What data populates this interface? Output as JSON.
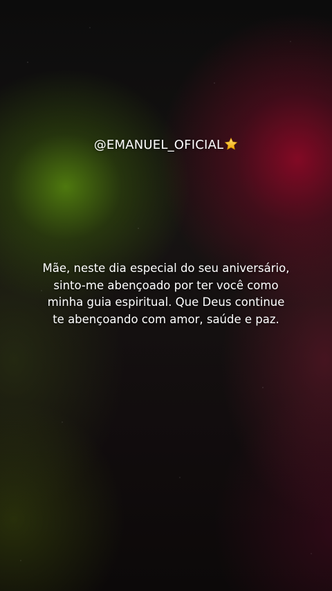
{
  "post": {
    "handle": "@EMANUEL_OFICIAL",
    "handle_icon": "star-icon",
    "message": "Mãe, neste dia especial do seu aniversário, sinto-me abençoado por ter você como minha guia espiritual. Que Deus continue te abençoando com amor, saúde e paz."
  },
  "colors": {
    "text": "#ffffff",
    "glow_green": "#588a0e",
    "glow_red": "#960828",
    "star": "#f5c518"
  }
}
